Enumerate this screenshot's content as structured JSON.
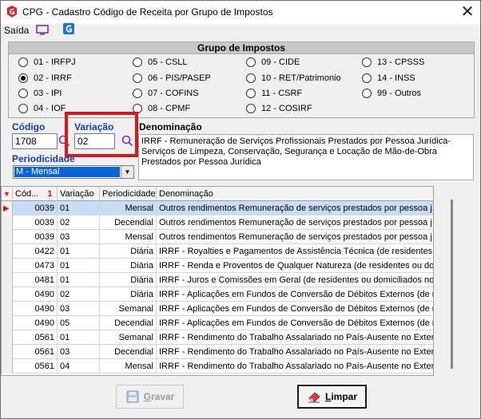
{
  "window": {
    "title": "CPG - Cadastro Código de Receita por Grupo de Impostos",
    "close": "✕"
  },
  "menu": {
    "saida": "Saída"
  },
  "grupo": {
    "title": "Grupo de Impostos",
    "options": [
      {
        "label": "01 - IRFPJ",
        "checked": false
      },
      {
        "label": "02 - IRRF",
        "checked": true
      },
      {
        "label": "03 - IPI",
        "checked": false
      },
      {
        "label": "04 - IOF",
        "checked": false
      },
      {
        "label": "05 - CSLL",
        "checked": false
      },
      {
        "label": "06 - PIS/PASEP",
        "checked": false
      },
      {
        "label": "07 - COFINS",
        "checked": false
      },
      {
        "label": "08 - CPMF",
        "checked": false
      },
      {
        "label": "09 - CIDE",
        "checked": false
      },
      {
        "label": "10 - RET/Patrimonio",
        "checked": false
      },
      {
        "label": "11 - CSRF",
        "checked": false
      },
      {
        "label": "12 - COSIRF",
        "checked": false
      },
      {
        "label": "13 - CPSSS",
        "checked": false
      },
      {
        "label": "14 - INSS",
        "checked": false
      },
      {
        "label": "99 - Outros",
        "checked": false
      }
    ]
  },
  "form": {
    "codigo_label": "Código",
    "codigo_value": "1708",
    "variacao_label": "Variação",
    "variacao_value": "02",
    "denominacao_label": "Denominação",
    "denominacao_value": "IRRF - Remuneração de Serviços Profissionais Prestados por Pessoa Jurídica-Serviços de Limpeza, Conservação, Segurança e Locação de Mão-de-Obra Prestados por Pessoa Jurídica",
    "periodicidade_label": "Periodicidade",
    "periodicidade_value": "M - Mensal"
  },
  "grid": {
    "headers": {
      "codigo": "Cód...",
      "sort_mark": "1",
      "variacao": "Variação",
      "periodicidade": "Periodicidade",
      "denominacao": "Denominação"
    },
    "rows": [
      {
        "codigo": "0039",
        "variacao": "01",
        "periodicidade": "Mensal",
        "denominacao": "Outros rendimentos  Remuneração de serviços prestados por pessoa j..."
      },
      {
        "codigo": "0039",
        "variacao": "02",
        "periodicidade": "Decendial",
        "denominacao": "Outros rendimentos  Remuneração de serviços prestados por pessoa j..."
      },
      {
        "codigo": "0039",
        "variacao": "03",
        "periodicidade": "Mensal",
        "denominacao": "Outros rendimentos  Remuneração de serviços prestados por pessoa j..."
      },
      {
        "codigo": "0422",
        "variacao": "01",
        "periodicidade": "Diária",
        "denominacao": "IRRF - Royalties e Pagamentos de Assistência Técnica (de residentes ..."
      },
      {
        "codigo": "0473",
        "variacao": "01",
        "periodicidade": "Diária",
        "denominacao": "IRRF - Renda e Proventos de Qualquer Natureza (de residentes ou do..."
      },
      {
        "codigo": "0481",
        "variacao": "01",
        "periodicidade": "Diária",
        "denominacao": "IRRF - Juros e Comissões em Geral (de residentes ou domiciliados no e..."
      },
      {
        "codigo": "0490",
        "variacao": "02",
        "periodicidade": "Diária",
        "denominacao": "IRRF - Aplicações em Fundos de Conversão de Débitos Externos (de r..."
      },
      {
        "codigo": "0490",
        "variacao": "03",
        "periodicidade": "Semanal",
        "denominacao": "IRRF - Aplicações em Fundos de Conversão de Débitos Externos (de r..."
      },
      {
        "codigo": "0490",
        "variacao": "05",
        "periodicidade": "Decendial",
        "denominacao": "IRRF - Aplicações em Fundos de Conversão de Débitos Externos (de r..."
      },
      {
        "codigo": "0561",
        "variacao": "01",
        "periodicidade": "Semanal",
        "denominacao": "IRRF - Rendimento do Trabalho Assalariado no País-Ausente no Exteri..."
      },
      {
        "codigo": "0561",
        "variacao": "03",
        "periodicidade": "Decendial",
        "denominacao": "IRRF - Rendimento do Trabalho Assalariado no País-Ausente no Exteri..."
      },
      {
        "codigo": "0561",
        "variacao": "04",
        "periodicidade": "Mensal",
        "denominacao": "IRRF - Rendimento do Trabalho Assalariado no País-Ausente no Exteri..."
      }
    ]
  },
  "buttons": {
    "gravar_rest": "ravar",
    "gravar_ul": "G",
    "limpar_rest": "impar",
    "limpar_ul": "L"
  }
}
